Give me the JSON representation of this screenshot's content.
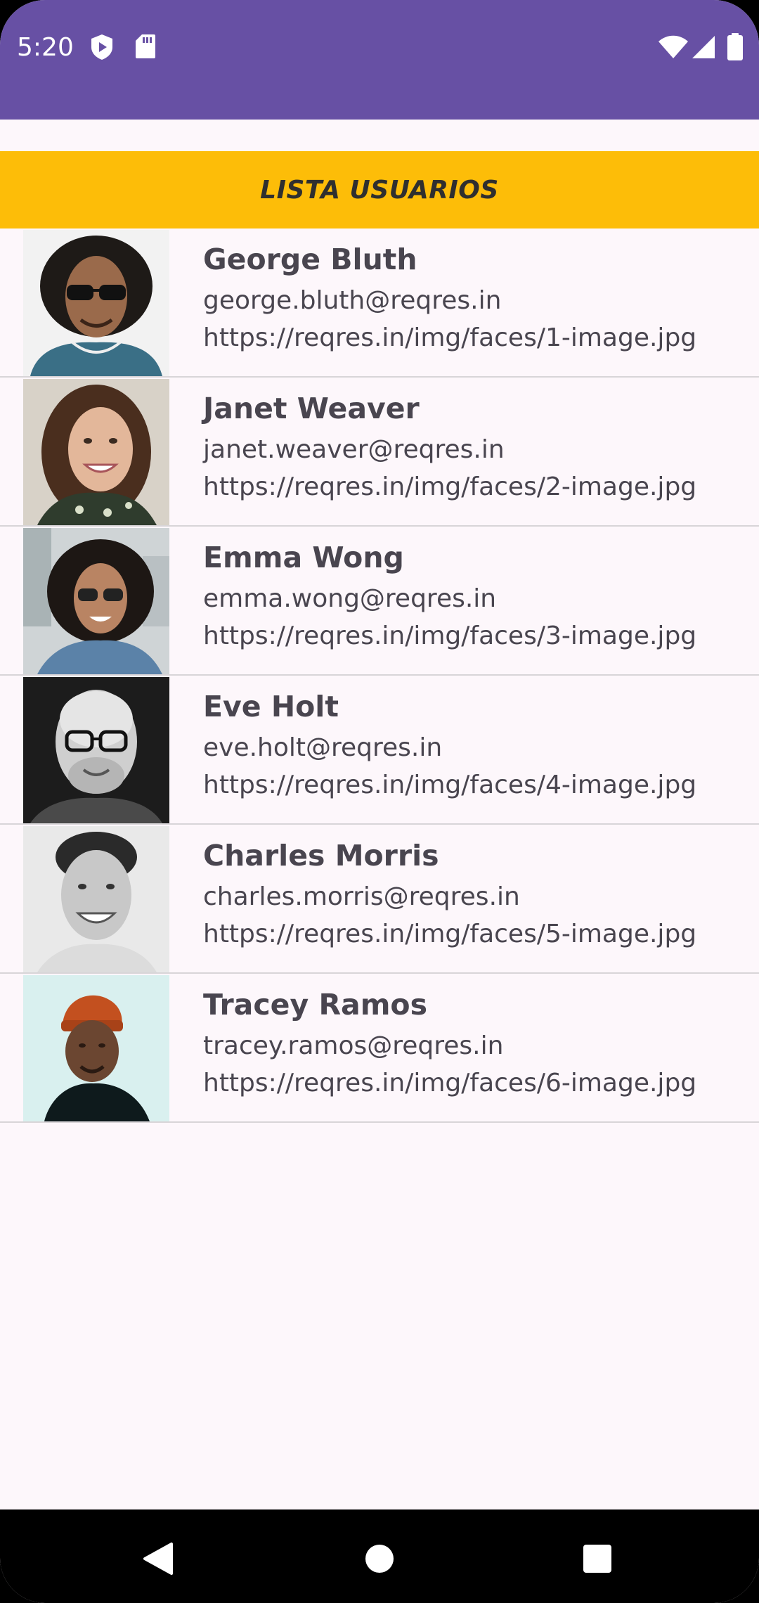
{
  "status_bar": {
    "time": "5:20",
    "left_icons": [
      "shield-play-icon",
      "sd-card-icon"
    ],
    "right_icons": [
      "wifi-icon",
      "cell-signal-icon",
      "battery-icon"
    ],
    "color": "#6750a4"
  },
  "banner": {
    "title": "LISTA USUARIOS",
    "color": "#fdbd08"
  },
  "users": [
    {
      "name": "George Bluth",
      "email": "george.bluth@reqres.in",
      "avatar_url": "https://reqres.in/img/faces/1-image.jpg"
    },
    {
      "name": "Janet Weaver",
      "email": "janet.weaver@reqres.in",
      "avatar_url": "https://reqres.in/img/faces/2-image.jpg"
    },
    {
      "name": "Emma Wong",
      "email": "emma.wong@reqres.in",
      "avatar_url": "https://reqres.in/img/faces/3-image.jpg"
    },
    {
      "name": "Eve Holt",
      "email": "eve.holt@reqres.in",
      "avatar_url": "https://reqres.in/img/faces/4-image.jpg"
    },
    {
      "name": "Charles Morris",
      "email": "charles.morris@reqres.in",
      "avatar_url": "https://reqres.in/img/faces/5-image.jpg"
    },
    {
      "name": "Tracey Ramos",
      "email": "tracey.ramos@reqres.in",
      "avatar_url": "https://reqres.in/img/faces/6-image.jpg"
    }
  ],
  "nav_bar": {
    "buttons": [
      "back-icon",
      "home-icon",
      "recents-icon"
    ]
  }
}
